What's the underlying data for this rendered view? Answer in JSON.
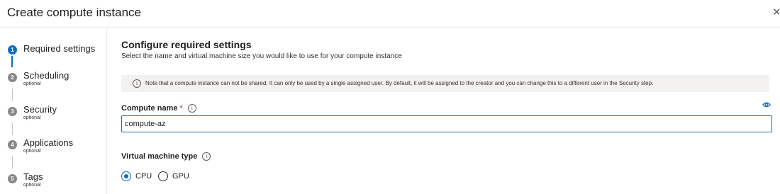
{
  "header": {
    "title": "Create compute instance",
    "close_glyph": "✕"
  },
  "steps": [
    {
      "num": "1",
      "label": "Required settings",
      "sub": ""
    },
    {
      "num": "2",
      "label": "Scheduling",
      "sub": "optional"
    },
    {
      "num": "3",
      "label": "Security",
      "sub": "optional"
    },
    {
      "num": "4",
      "label": "Applications",
      "sub": "optional"
    },
    {
      "num": "5",
      "label": "Tags",
      "sub": "optional"
    }
  ],
  "main": {
    "title": "Configure required settings",
    "description": "Select the name and virtual machine size you would like to use for your compute instance",
    "note": "Note that a compute instance can not be shared. It can only be used by a single assigned user. By default, it will be assigned to the creator and you can change this to a different user in the Security step.",
    "info_glyph": "i",
    "compute_name": {
      "label": "Compute name",
      "required_mark": "*",
      "value": "compute-az"
    },
    "vm_type": {
      "label": "Virtual machine type",
      "options": [
        {
          "label": "CPU",
          "selected": true
        },
        {
          "label": "GPU",
          "selected": false
        }
      ]
    }
  },
  "colors": {
    "accent": "#0f6cbd",
    "required": "#a4262c",
    "note_bg": "#f3f2f1"
  }
}
